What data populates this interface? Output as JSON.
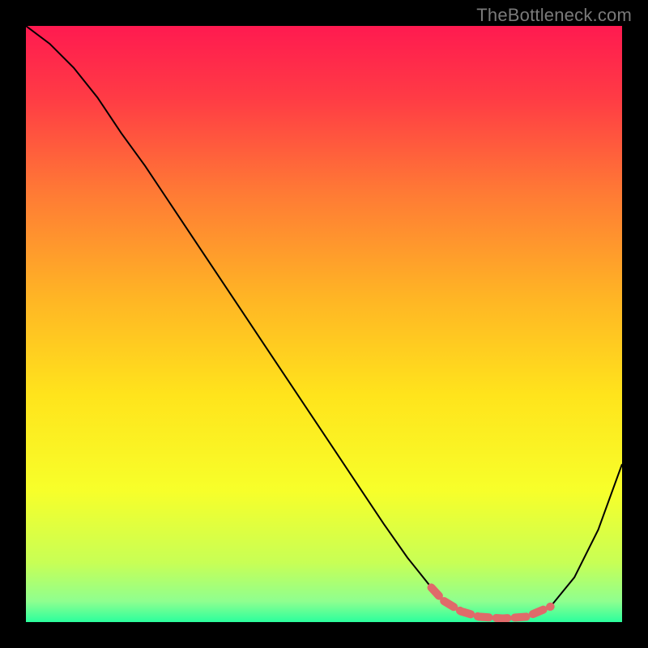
{
  "watermark": "TheBottleneck.com",
  "chart_data": {
    "type": "line",
    "title": "",
    "xlabel": "",
    "ylabel": "",
    "xlim": [
      0,
      100
    ],
    "ylim": [
      0,
      100
    ],
    "background_gradient": {
      "stops": [
        {
          "offset": 0.0,
          "color": "#ff1a50"
        },
        {
          "offset": 0.12,
          "color": "#ff3b45"
        },
        {
          "offset": 0.28,
          "color": "#ff7a35"
        },
        {
          "offset": 0.45,
          "color": "#ffb325"
        },
        {
          "offset": 0.62,
          "color": "#ffe41c"
        },
        {
          "offset": 0.78,
          "color": "#f7ff2a"
        },
        {
          "offset": 0.9,
          "color": "#c8ff55"
        },
        {
          "offset": 0.965,
          "color": "#8fff8f"
        },
        {
          "offset": 1.0,
          "color": "#2bff9d"
        }
      ]
    },
    "series": [
      {
        "name": "curve",
        "color": "#000000",
        "width": 2,
        "x": [
          0,
          4,
          8,
          12,
          16,
          20,
          24,
          28,
          32,
          36,
          40,
          44,
          48,
          52,
          56,
          60,
          64,
          68,
          70,
          73,
          76,
          80,
          84,
          88,
          92,
          96,
          100
        ],
        "values": [
          100,
          97,
          93,
          88,
          82,
          76.5,
          70.5,
          64.5,
          58.5,
          52.5,
          46.5,
          40.5,
          34.5,
          28.5,
          22.5,
          16.5,
          10.8,
          5.8,
          3.6,
          1.8,
          0.9,
          0.6,
          0.9,
          2.6,
          7.5,
          15.5,
          26.5
        ]
      },
      {
        "name": "highlight",
        "color": "#e06a6a",
        "width": 10,
        "dash": [
          14,
          9
        ],
        "linecap": "round",
        "x": [
          68,
          70,
          73,
          76,
          80,
          84,
          88
        ],
        "values": [
          5.8,
          3.6,
          1.8,
          0.9,
          0.6,
          0.9,
          2.6
        ]
      }
    ]
  }
}
